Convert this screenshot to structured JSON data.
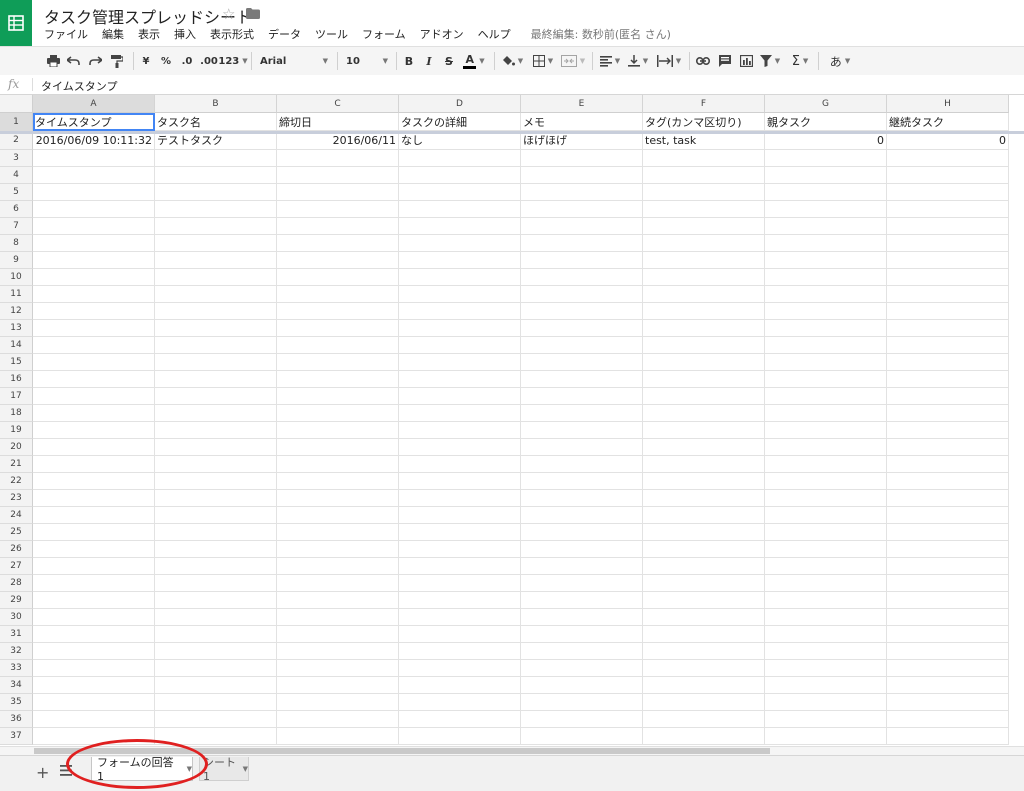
{
  "app": {
    "title": "タスク管理スプレッドシート",
    "last_edit": "最終編集: 数秒前(匿名 さん)",
    "menu": [
      "ファイル",
      "編集",
      "表示",
      "挿入",
      "表示形式",
      "データ",
      "ツール",
      "フォーム",
      "アドオン",
      "ヘルプ"
    ]
  },
  "toolbar": {
    "currency": "¥",
    "percent": "%",
    "dec_decrease": ".0",
    "dec_increase": ".00",
    "more_formats": "123",
    "font": "Arial",
    "font_size": "10",
    "bold": "B",
    "italic": "I",
    "strike": "S",
    "text_color": "A",
    "input_tools": "あ"
  },
  "formula_bar": {
    "fx": "fx",
    "value": "タイムスタンプ"
  },
  "sheet": {
    "columns": [
      "A",
      "B",
      "C",
      "D",
      "E",
      "F",
      "G",
      "H"
    ],
    "rows": [
      [
        "タイムスタンプ",
        "タスク名",
        "締切日",
        "タスクの詳細",
        "メモ",
        "タグ(カンマ区切り)",
        "親タスク",
        "継続タスク"
      ],
      [
        "2016/06/09 10:11:32",
        "テストタスク",
        "2016/06/11",
        "なし",
        "ほげほげ",
        "test, task",
        "0",
        "0"
      ]
    ],
    "row_count": 37
  },
  "tabs": {
    "add": "+",
    "list_icon": "≡",
    "sheet1": "フォームの回答 1",
    "sheet2": "シート1"
  },
  "colors": {
    "brand": "#0f9d58",
    "selection": "#4285f4",
    "annotation": "#e02020"
  }
}
